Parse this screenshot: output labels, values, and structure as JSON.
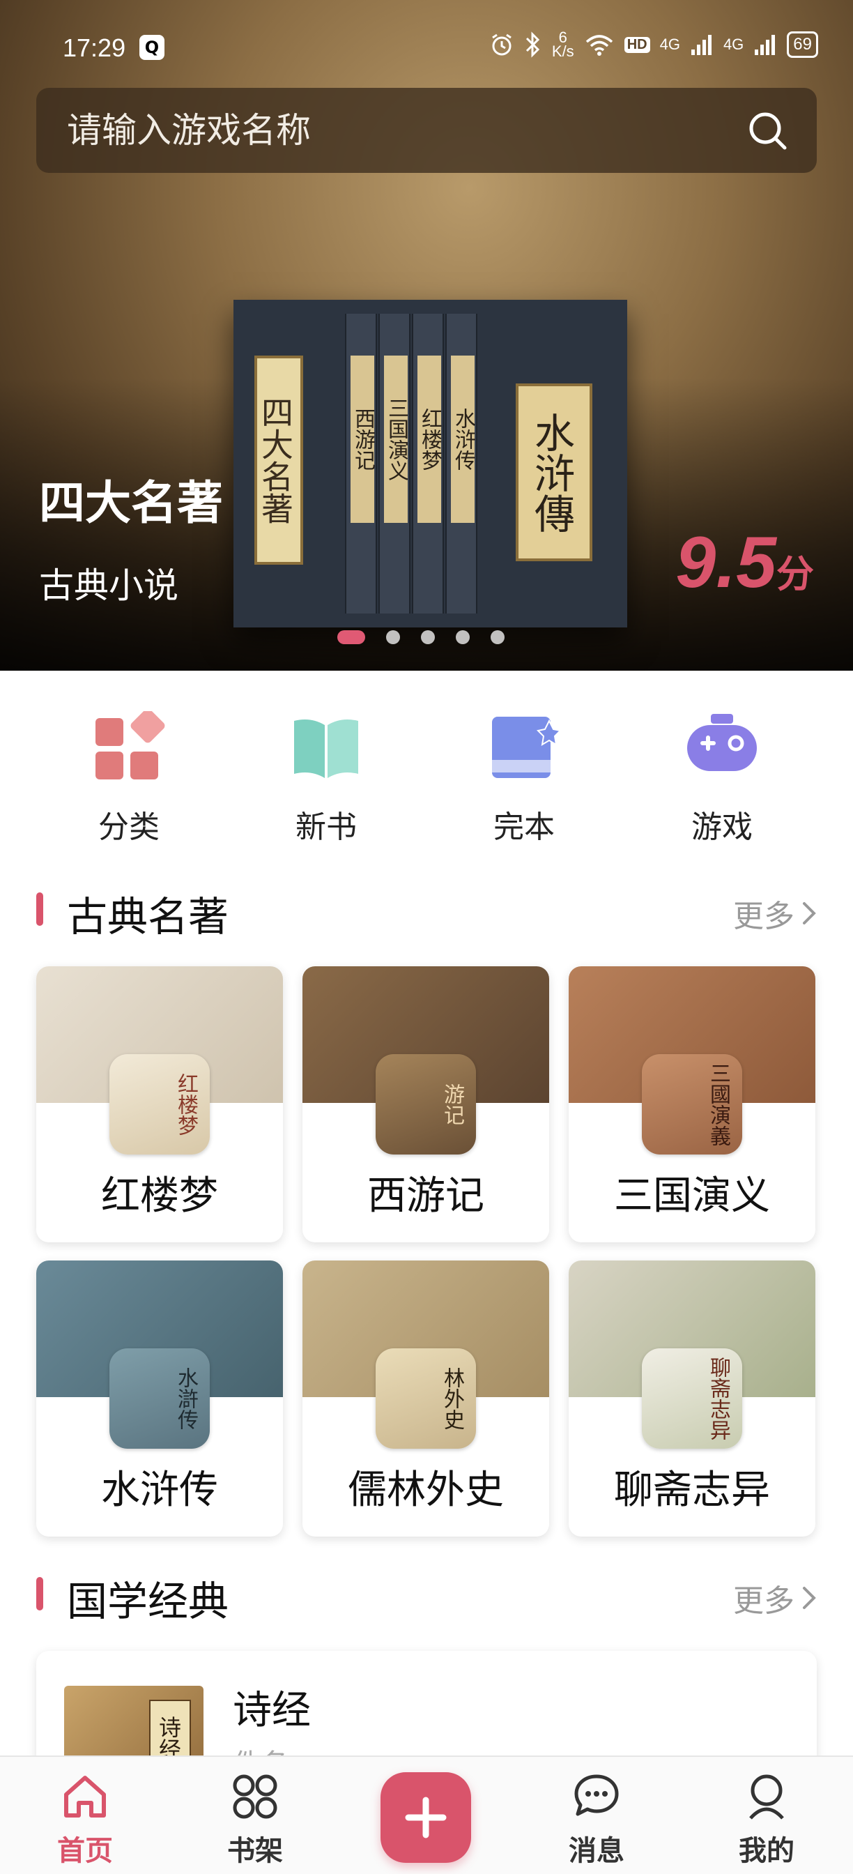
{
  "status_bar": {
    "time": "17:29",
    "qq_badge": "Q",
    "network_speed_top": "6",
    "network_speed_unit": "K/s",
    "hd_label": "HD",
    "signal_1": "4G",
    "signal_2": "4G",
    "battery": "69"
  },
  "search": {
    "placeholder": "请输入游戏名称"
  },
  "hero": {
    "title": "四大名著",
    "subtitle": "古典小说",
    "score": "9.5",
    "score_unit": "分",
    "slide_index": 1,
    "slide_count": 5,
    "box_left_panel": "四大名著",
    "spines": [
      "西游记",
      "三国演义",
      "红楼梦",
      "水浒传"
    ],
    "box_right_cover": "水浒傳"
  },
  "quick_nav": [
    {
      "label": "分类",
      "icon": "category-icon",
      "color": "#e07b7b"
    },
    {
      "label": "新书",
      "icon": "open-book-icon",
      "color": "#7ed0c0"
    },
    {
      "label": "完本",
      "icon": "finished-book-icon",
      "color": "#7a8ee8"
    },
    {
      "label": "游戏",
      "icon": "gamepad-icon",
      "color": "#8a7ee6"
    }
  ],
  "section_classics": {
    "title": "古典名著",
    "more": "更多",
    "items": [
      {
        "name": "红楼梦",
        "thumb_text": "红楼梦"
      },
      {
        "name": "西游记",
        "thumb_text": "游记"
      },
      {
        "name": "三国演义",
        "thumb_text": "三國演義"
      },
      {
        "name": "水浒传",
        "thumb_text": "水滸传"
      },
      {
        "name": "儒林外史",
        "thumb_text": "林外史"
      },
      {
        "name": "聊斋志异",
        "thumb_text": "聊斋志异"
      }
    ]
  },
  "section_guoxue": {
    "title": "国学经典",
    "more": "更多",
    "first_item": {
      "title": "诗经",
      "author": "佚名",
      "cover_text": "诗经"
    }
  },
  "tab_bar": {
    "tabs": [
      {
        "label": "首页",
        "icon": "home-icon",
        "active": true
      },
      {
        "label": "书架",
        "icon": "bookshelf-icon",
        "active": false
      },
      {
        "label": "消息",
        "icon": "message-icon",
        "active": false
      },
      {
        "label": "我的",
        "icon": "profile-icon",
        "active": false
      }
    ],
    "add_label": "+"
  },
  "colors": {
    "accent": "#d9546b",
    "muted": "#999999"
  }
}
